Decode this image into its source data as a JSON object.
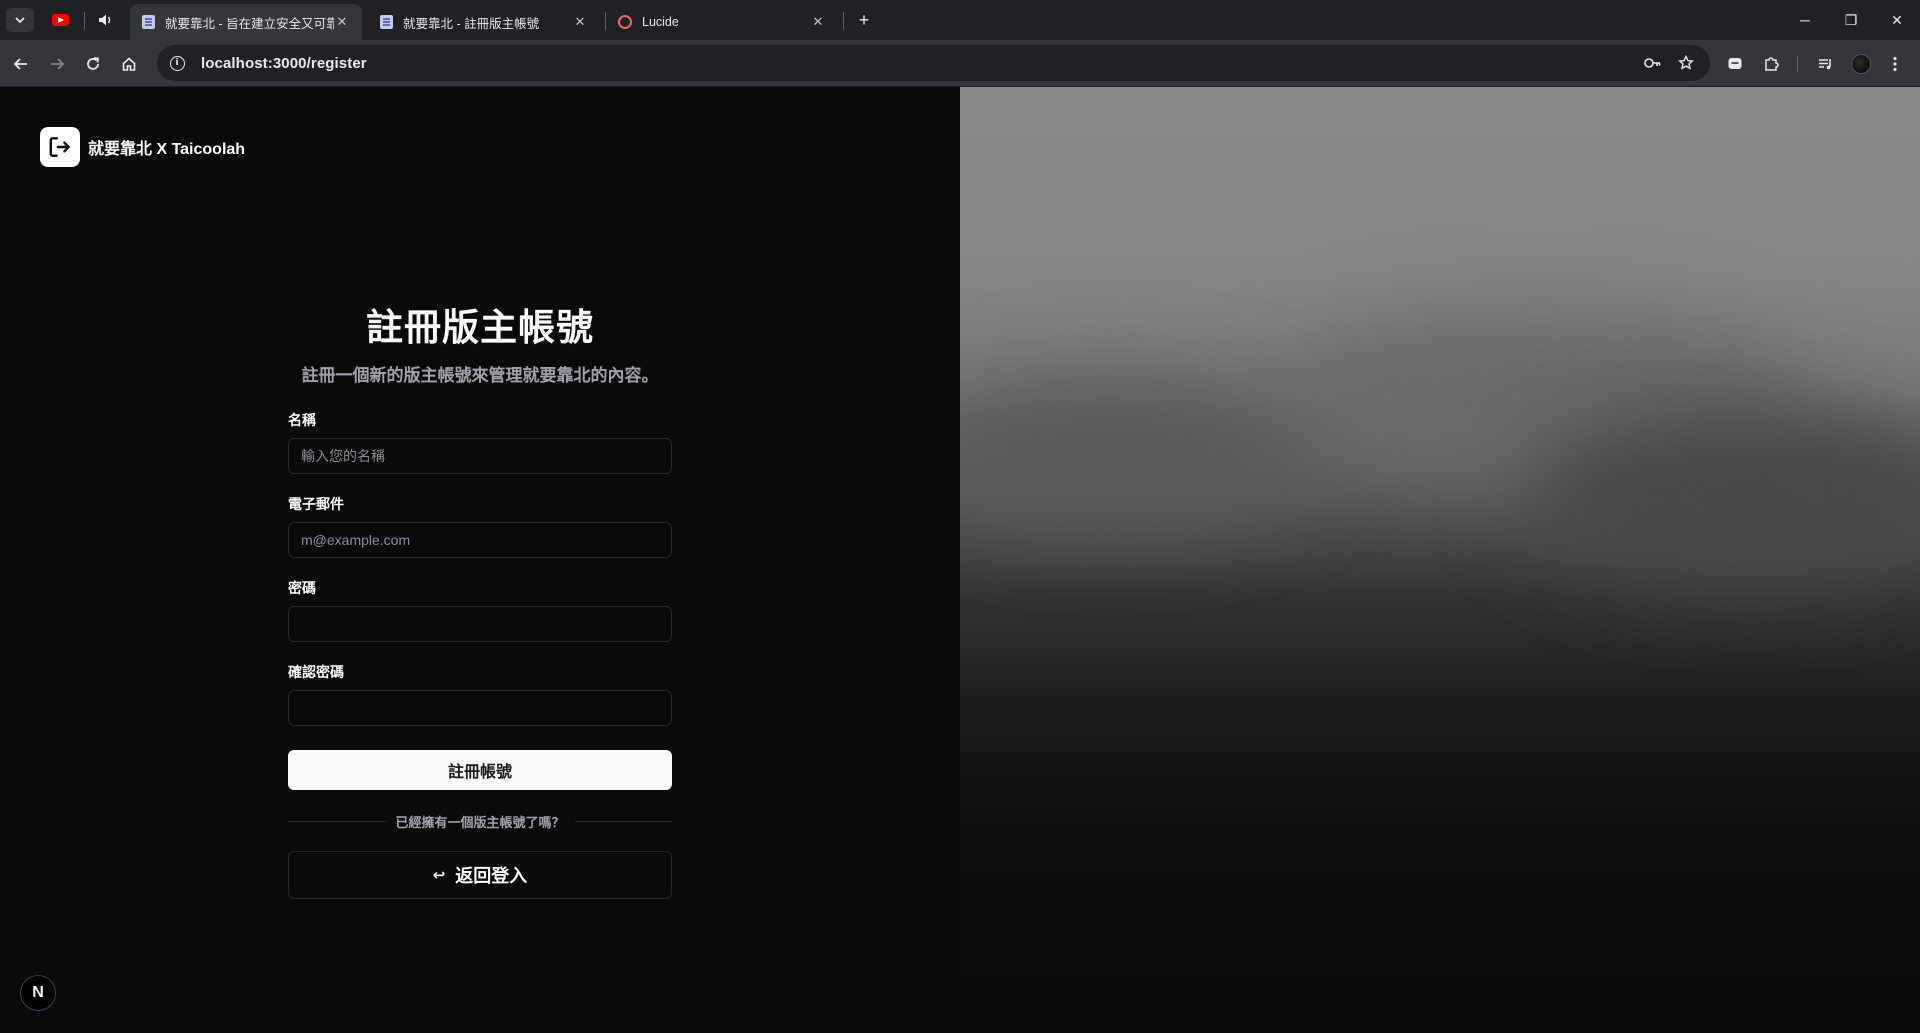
{
  "browser": {
    "tabs": [
      {
        "title": "就要靠北 - 旨在建立安全又可靠",
        "active": true
      },
      {
        "title": "就要靠北 - 註冊版主帳號",
        "active": false
      },
      {
        "title": "Lucide",
        "active": false
      }
    ],
    "new_tab_label": "+",
    "url": "localhost:3000/register",
    "window": {
      "minimize": "─",
      "restore": "❐",
      "close": "✕"
    }
  },
  "brand": {
    "name": "就要靠北 X Taicoolah"
  },
  "form": {
    "title": "註冊版主帳號",
    "subtitle": "註冊一個新的版主帳號來管理就要靠北的內容。",
    "fields": [
      {
        "label": "名稱",
        "placeholder": "輸入您的名稱",
        "type": "text"
      },
      {
        "label": "電子郵件",
        "placeholder": "m@example.com",
        "type": "email"
      },
      {
        "label": "密碼",
        "placeholder": "",
        "type": "password"
      },
      {
        "label": "確認密碼",
        "placeholder": "",
        "type": "password"
      }
    ],
    "submit_label": "註冊帳號",
    "divider_text": "已經擁有一個版主帳號了嗎？",
    "back_label": "返回登入",
    "back_icon": "↩"
  },
  "next_badge": "N",
  "colors": {
    "background": "#0a0a0a",
    "foreground": "#fafafa",
    "border": "#27272a",
    "muted": "#a1a1aa"
  }
}
